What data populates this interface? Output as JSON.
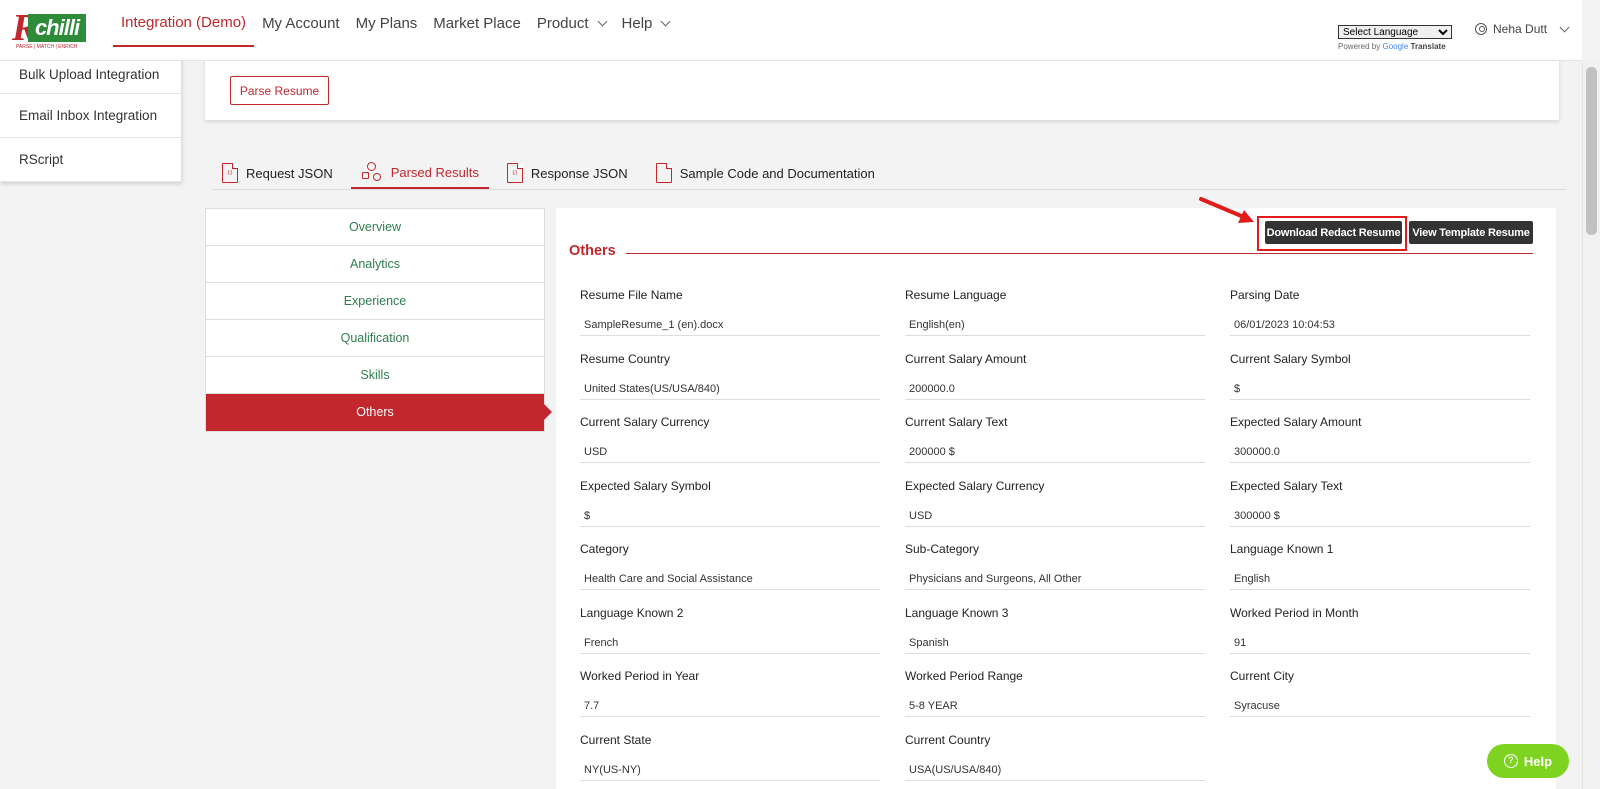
{
  "brand": {
    "tagline": "PARSE | MATCH | ENRICH"
  },
  "nav": {
    "items": [
      {
        "label": "Integration (Demo)",
        "active": true,
        "dropdown": false
      },
      {
        "label": "My Account",
        "active": false,
        "dropdown": false
      },
      {
        "label": "My Plans",
        "active": false,
        "dropdown": false
      },
      {
        "label": "Market Place",
        "active": false,
        "dropdown": false
      },
      {
        "label": "Product",
        "active": false,
        "dropdown": true
      },
      {
        "label": "Help",
        "active": false,
        "dropdown": true
      }
    ],
    "language_select": "Select Language",
    "powered_by": "Powered by",
    "google": "Google",
    "translate": "Translate",
    "user_name": "Neha Dutt"
  },
  "leftmenu": [
    "Bulk Upload Integration",
    "Email Inbox Integration",
    "RScript"
  ],
  "parse_button": "Parse Resume",
  "tabs": [
    {
      "label": "Request JSON",
      "icon": "json-file-icon",
      "active": false
    },
    {
      "label": "Parsed Results",
      "icon": "parsed-results-icon",
      "active": true
    },
    {
      "label": "Response JSON",
      "icon": "json-file-icon",
      "active": false
    },
    {
      "label": "Sample Code and Documentation",
      "icon": "documentation-icon",
      "active": false
    }
  ],
  "subnav": [
    "Overview",
    "Analytics",
    "Experience",
    "Qualification",
    "Skills",
    "Others"
  ],
  "subnav_active": "Others",
  "panel": {
    "download_button": "Download Redact Resume",
    "view_template_button": "View Template Resume",
    "section_title": "Others",
    "fields": [
      {
        "label": "Resume File Name",
        "value": "SampleResume_1 (en).docx"
      },
      {
        "label": "Resume Language",
        "value": "English(en)"
      },
      {
        "label": "Parsing Date",
        "value": "06/01/2023 10:04:53"
      },
      {
        "label": "Resume Country",
        "value": "United States(US/USA/840)"
      },
      {
        "label": "Current Salary Amount",
        "value": "200000.0"
      },
      {
        "label": "Current Salary Symbol",
        "value": "$"
      },
      {
        "label": "Current Salary Currency",
        "value": "USD"
      },
      {
        "label": "Current Salary Text",
        "value": "200000 $"
      },
      {
        "label": "Expected Salary Amount",
        "value": "300000.0"
      },
      {
        "label": "Expected Salary Symbol",
        "value": "$"
      },
      {
        "label": "Expected Salary Currency",
        "value": "USD"
      },
      {
        "label": "Expected Salary Text",
        "value": "300000 $"
      },
      {
        "label": "Category",
        "value": "Health Care and Social Assistance"
      },
      {
        "label": "Sub-Category",
        "value": "Physicians and Surgeons, All Other"
      },
      {
        "label": "Language Known 1",
        "value": "English"
      },
      {
        "label": "Language Known 2",
        "value": "French"
      },
      {
        "label": "Language Known 3",
        "value": "Spanish"
      },
      {
        "label": "Worked Period in Month",
        "value": "91"
      },
      {
        "label": "Worked Period in Year",
        "value": "7.7"
      },
      {
        "label": "Worked Period Range",
        "value": "5-8 YEAR"
      },
      {
        "label": "Current City",
        "value": "Syracuse"
      },
      {
        "label": "Current State",
        "value": "NY(US-NY)"
      },
      {
        "label": "Current Country",
        "value": "USA(US/USA/840)"
      }
    ]
  },
  "help_widget": "Help",
  "colors": {
    "brand_red": "#c1272d",
    "brand_green": "#2e8b3a",
    "help_green": "#7ed321",
    "highlight": "#e21b1b"
  }
}
